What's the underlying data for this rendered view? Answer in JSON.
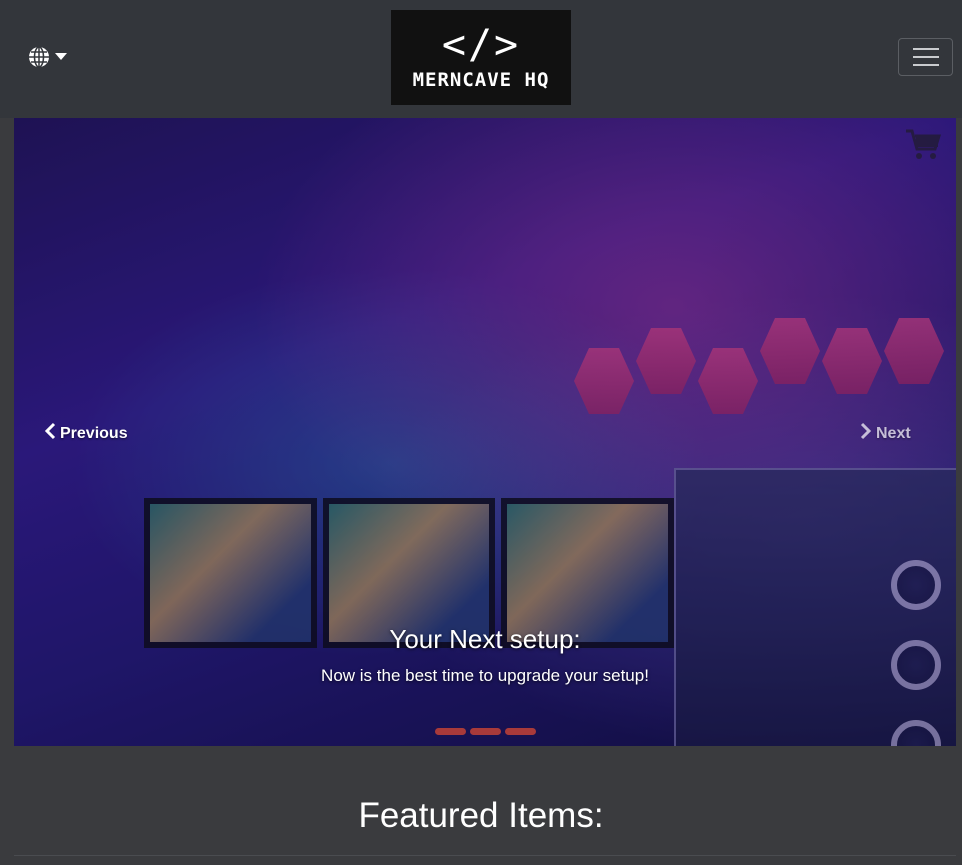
{
  "navbar": {
    "language_icon": "globe-icon",
    "logo_mark": "</>",
    "logo_text": "MERNCAVE HQ",
    "menu_icon": "hamburger-icon"
  },
  "hero": {
    "cart_icon": "cart-icon",
    "prev_label": "Previous",
    "next_label": "Next",
    "caption_title": "Your Next setup:",
    "caption_text": "Now is the best time to upgrade your setup!",
    "indicator_count": 3
  },
  "featured": {
    "title": "Featured Items:"
  },
  "colors": {
    "navbar_bg": "#33363b",
    "indicator": "#a83a3a"
  }
}
